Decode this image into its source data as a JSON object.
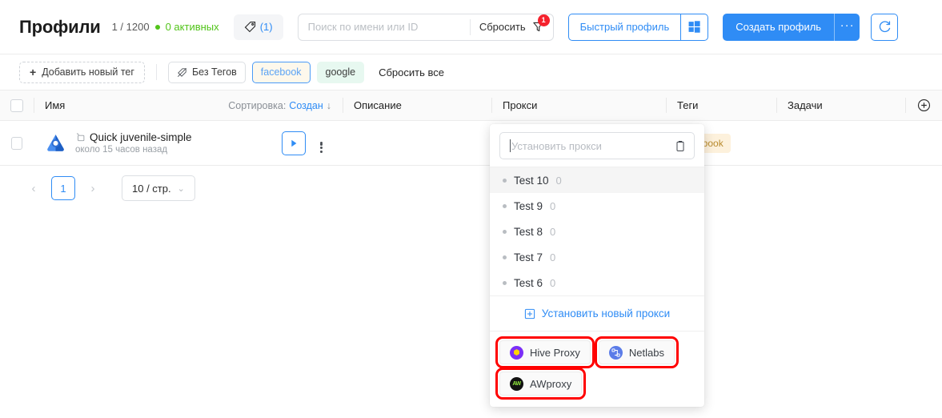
{
  "header": {
    "title": "Профили",
    "count": "1 / 1200",
    "active": "0 активных",
    "tag_count_label": "(1)",
    "search_placeholder": "Поиск по имени или ID",
    "reset_label": "Сбросить",
    "filter_badge": "1",
    "quick_profile_label": "Быстрый профиль",
    "create_profile_label": "Создать профиль",
    "more_label": "···"
  },
  "tagbar": {
    "add_tag_label": "Добавить новый тег",
    "add_tag_plus": "+",
    "chips": [
      {
        "label": "Без Тегов",
        "kind": "notag"
      },
      {
        "label": "facebook",
        "kind": "fb"
      },
      {
        "label": "google",
        "kind": "gg"
      }
    ],
    "reset_all_label": "Сбросить все"
  },
  "table": {
    "columns": {
      "name": "Имя",
      "sort_prefix": "Сортировка:",
      "sort_value": "Создан",
      "sort_arrow": "↓",
      "description": "Описание",
      "proxy": "Прокси",
      "tags": "Теги",
      "tasks": "Задачи"
    },
    "rows": [
      {
        "name": "Quick juvenile-simple",
        "time": "около 15 часов назад",
        "description": "",
        "tag": "facebook",
        "tasks": ""
      }
    ]
  },
  "pagination": {
    "prev": "‹",
    "page": "1",
    "next": "›",
    "page_size": "10 / стр.",
    "page_size_caret": "⌄"
  },
  "proxy_dropdown": {
    "input_placeholder": "Установить прокси",
    "items": [
      {
        "label": "Test 10",
        "count": "0",
        "highlighted": true
      },
      {
        "label": "Test 9",
        "count": "0",
        "highlighted": false
      },
      {
        "label": "Test 8",
        "count": "0",
        "highlighted": false
      },
      {
        "label": "Test 7",
        "count": "0",
        "highlighted": false
      },
      {
        "label": "Test 6",
        "count": "0",
        "highlighted": false
      }
    ],
    "new_proxy_label": "Установить новый прокси",
    "providers": [
      {
        "label": "Hive Proxy",
        "icon": "hive-proxy-icon",
        "highlight": true
      },
      {
        "label": "Netlabs",
        "icon": "netlabs-icon",
        "highlight": true
      },
      {
        "label": "AWproxy",
        "icon": "awproxy-icon",
        "highlight": true
      }
    ]
  },
  "colors": {
    "accent": "#2f8cf5",
    "success": "#52c41a",
    "danger": "#f5222d",
    "highlight_box": "#ff0000"
  }
}
